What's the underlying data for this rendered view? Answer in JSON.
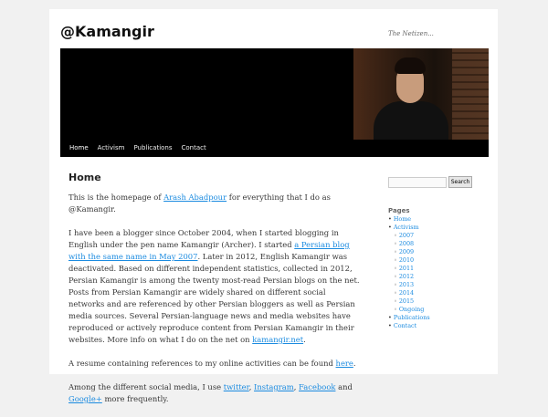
{
  "site": {
    "title": "@Kamangir",
    "description": "The Netizen..."
  },
  "nav": {
    "items": [
      "Home",
      "Activism",
      "Publications",
      "Contact"
    ]
  },
  "content": {
    "heading": "Home",
    "p1": {
      "before": "This is the homepage of ",
      "link": "Arash Abadpour",
      "after": " for everything that I do as @Kamangir."
    },
    "p2": {
      "before": "I have been a blogger since October 2004, when I started blogging in English under the pen name Kamangir (Archer). I started ",
      "link": "a Persian blog with the same name in May 2007",
      "middle": ". Later in 2012, English Kamangir was deactivated. Based on different independent statistics, collected in 2012, Persian Kamangir is among the twenty most-read Persian blogs on the net. Posts from Persian Kamangir are widely shared on different social networks and are referenced by other Persian bloggers as well as Persian media sources. Several Persian-language news and media websites have reproduced or actively reproduce content from Persian Kamangir in their websites. More info on what I do on the net on ",
      "link2": "kamangir.net",
      "after": "."
    },
    "p3": {
      "before": "A resume containing references to my online activities can be found ",
      "link": "here",
      "after": "."
    },
    "p4": {
      "before": "Among the different social media, I use ",
      "link1": "twitter",
      "sep1": ", ",
      "link2": "Instagram",
      "sep2": ", ",
      "link3": "Facebook",
      "sep3": " and ",
      "link4": "Google+",
      "after": " more frequently."
    }
  },
  "sidebar": {
    "search_button": "Search",
    "pages_title": "Pages",
    "pages": {
      "home": "Home",
      "activism": "Activism",
      "years": [
        "2007",
        "2008",
        "2009",
        "2010",
        "2011",
        "2012",
        "2013",
        "2014",
        "2015",
        "Ongoing"
      ],
      "publications": "Publications",
      "contact": "Contact"
    }
  }
}
